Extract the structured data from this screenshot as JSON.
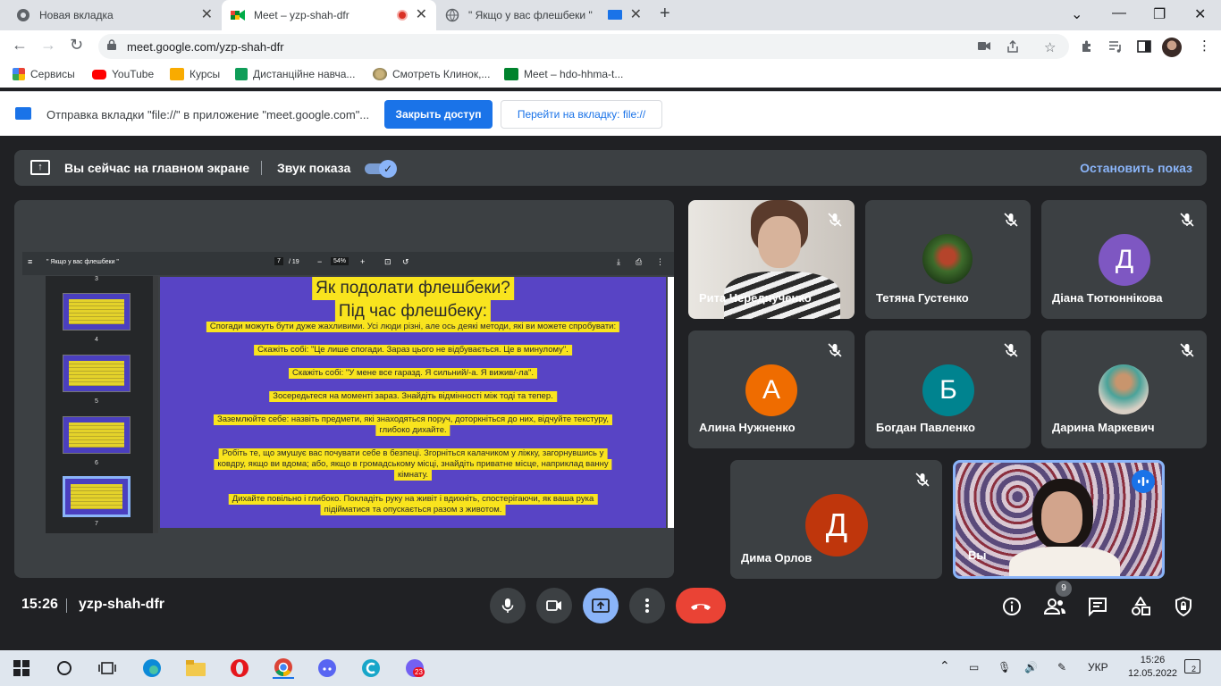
{
  "browser": {
    "tabs": [
      {
        "title": "Новая вкладка"
      },
      {
        "title": "Meet – yzp-shah-dfr"
      },
      {
        "title": "\" Якщо у вас флешбеки \""
      }
    ],
    "url": "meet.google.com/yzp-shah-dfr",
    "bookmarks": [
      "Сервисы",
      "YouTube",
      "Курсы",
      "Дистанційне навча...",
      "Смотреть Клинок,...",
      "Meet – hdo-hhma-t..."
    ],
    "infobar": {
      "text": "Отправка вкладки \"file://\" в приложение \"meet.google.com\"...",
      "close_access": "Закрыть доступ",
      "goto_tab": "Перейти на вкладку: file://"
    }
  },
  "meet": {
    "banner": {
      "main_screen_text": "Вы сейчас на главном экране",
      "sound_label": "Звук показа",
      "stop_label": "Остановить показ"
    },
    "pdf": {
      "title": "\" Якщо у вас флешбеки \"",
      "page": "7",
      "pages_total": "/ 19",
      "zoom": "54%",
      "thumb_numbers": [
        "3",
        "4",
        "5",
        "6",
        "7"
      ]
    },
    "slide": {
      "heading1": "Як подолати флешбеки?",
      "heading2": "Під час флешбеку:",
      "lines": [
        "Спогади можуть бути дуже жахливими. Усі люди різні, але ось деякі методи, які ви можете спробувати:",
        "Скажіть собі: \"Це лише спогади. Зараз цього не відбувається. Це в минулому\".",
        "Скажіть собі: \"У мене все гаразд. Я сильний/-а. Я вижив/-ла\".",
        "Зосередьтеся на моменті зараз. Знайдіть відмінності між тоді та тепер.",
        "Заземлюйте себе: назвіть предмети, які знаходяться поруч, доторкніться до них, відчуйте текстуру,",
        "глибоко дихайте.",
        "Робіть те, що змушує вас почувати себе в безпеці. Згорніться калачиком у ліжку, загорнувшись у",
        "ковдру, якщо ви вдома; або, якщо в громадському місці, знайдіть приватне місце, наприклад ванну",
        "кімнату.",
        "Дихайте повільно і глибоко. Покладіть руку на живіт і вдихніть, спостерігаючи, як ваша рука",
        "підійматися та опускається разом з животом."
      ]
    },
    "participants": [
      {
        "name": "Рита Череднyченко",
        "initial": "",
        "color": ""
      },
      {
        "name": "Тетяна Густенко",
        "initial": "",
        "color": ""
      },
      {
        "name": "Діана Тютюннікова",
        "initial": "Д",
        "color": "#7e57c2"
      },
      {
        "name": "Алина Нужненко",
        "initial": "А",
        "color": "#ef6c00"
      },
      {
        "name": "Богдан Павленко",
        "initial": "Б",
        "color": "#00838f"
      },
      {
        "name": "Дарина Маркевич",
        "initial": "",
        "color": ""
      },
      {
        "name": "Дима Орлов",
        "initial": "Д",
        "color": "#bf360c"
      },
      {
        "name": "Вы",
        "initial": "",
        "color": ""
      }
    ],
    "bottom": {
      "time": "15:26",
      "meeting_code": "yzp-shah-dfr",
      "participants_count": "9"
    }
  },
  "taskbar": {
    "lang": "УКР",
    "time": "15:26",
    "date": "12.05.2022",
    "notif_count": "2",
    "viber_badge": "23"
  }
}
